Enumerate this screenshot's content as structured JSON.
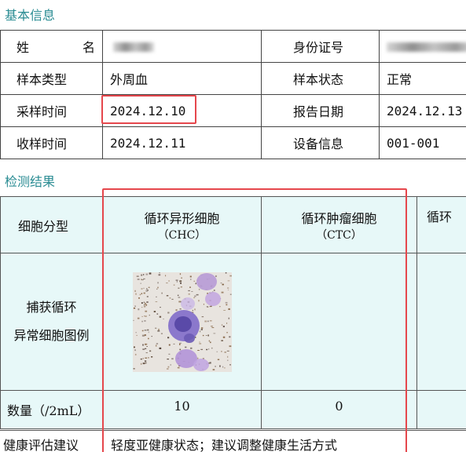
{
  "sections": {
    "basic_info": "基本信息",
    "results": "检测结果"
  },
  "info": {
    "name_label": "姓　名",
    "id_label": "身份证号",
    "sample_type_label": "样本类型",
    "sample_type_value": "外周血",
    "sample_status_label": "样本状态",
    "sample_status_value": "正常",
    "collect_time_label": "采样时间",
    "collect_time_value": "2024.12.10",
    "report_date_label": "报告日期",
    "report_date_value": "2024.12.13",
    "receive_time_label": "收样时间",
    "receive_time_value": "2024.12.11",
    "device_label": "设备信息",
    "device_value": "001-001"
  },
  "results": {
    "row_type_label": "细胞分型",
    "row_image_label_1": "捕获循环",
    "row_image_label_2": "异常细胞图例",
    "row_count_label": "数量（/2mL）",
    "col1_title": "循环异形细胞",
    "col1_abbr": "（CHC）",
    "col2_title": "循环肿瘤细胞",
    "col2_abbr": "（CTC）",
    "col3_title": "循环",
    "col1_count": "10",
    "col2_count": "0"
  },
  "advice": {
    "label": "健康评估建议",
    "value": "轻度亚健康状态；建议调整健康生活方式"
  },
  "colors": {
    "section_title": "#2a8c93",
    "table_fill": "#e7f8f8",
    "highlight": "#e5474c"
  }
}
